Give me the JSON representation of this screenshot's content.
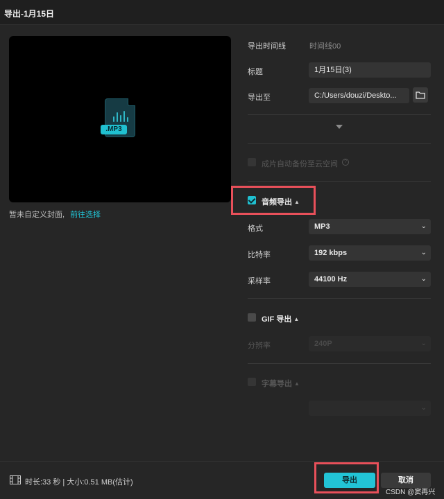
{
  "window": {
    "title": "导出-1月15日"
  },
  "preview": {
    "file_ext": ".MP3",
    "cover_note": "暂未自定义封面,",
    "cover_link": "前往选择"
  },
  "settings": {
    "timeline_label": "导出时间线",
    "timeline_value": "时间线00",
    "title_label": "标题",
    "title_value": "1月15日(3)",
    "export_to_label": "导出至",
    "export_to_value": "C:/Users/douzi/Deskto...",
    "cloud_backup_label": "成片自动备份至云空间"
  },
  "audio_export": {
    "enabled": true,
    "label": "音频导出",
    "format_label": "格式",
    "format_value": "MP3",
    "bitrate_label": "比特率",
    "bitrate_value": "192 kbps",
    "samplerate_label": "采样率",
    "samplerate_value": "44100 Hz"
  },
  "gif_export": {
    "enabled": false,
    "label": "GIF 导出",
    "resolution_label": "分辨率",
    "resolution_value": "240P"
  },
  "subtitle_export": {
    "enabled": false,
    "label": "字幕导出"
  },
  "footer": {
    "info": "时长:33 秒 | 大小:0.51 MB(估计)",
    "export_button": "导出",
    "cancel_button": "取消",
    "watermark": "CSDN @窦再兴"
  },
  "colors": {
    "accent": "#22c4d6",
    "highlight": "#e8505a",
    "background": "#262626"
  }
}
